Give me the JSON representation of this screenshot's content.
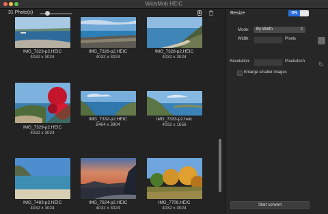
{
  "window": {
    "title": "WidsMob HEIC"
  },
  "toolbar": {
    "photo_count": "31 Photo(s)",
    "zoom": 0.2,
    "icons": [
      "phone-icon",
      "trash-icon"
    ]
  },
  "photos": [
    {
      "name": "IMG_7323-p2.HEIC",
      "size": "4032 x 3024",
      "scene": "lake"
    },
    {
      "name": "IMG_7326-p2.HEIC",
      "size": "4032 x 3024",
      "scene": "beach"
    },
    {
      "name": "IMG_7328-p2.HEIC",
      "size": "4032 x 3024",
      "scene": "coast"
    },
    {
      "name": "IMG_7329-p2.HEIC",
      "size": "4032 x 3024",
      "scene": "flowers"
    },
    {
      "name": "IMG_7332-p2.HEIC",
      "size": "8464 x 3904",
      "scene": "bay"
    },
    {
      "name": "IMG_7333-p2.heic",
      "size": "4032 x 1656",
      "scene": "hills"
    },
    {
      "name": "IMG_7483-p2.HEIC",
      "size": "4032 x 3024",
      "scene": "sea"
    },
    {
      "name": "IMG_7624-p2.HEIC",
      "size": "4032 x 3024",
      "scene": "sunset"
    },
    {
      "name": "IMG_7708.HEIC",
      "size": "4032 x 3024",
      "scene": "autumn"
    }
  ],
  "settings": {
    "title": "Resize",
    "toggle": "ON",
    "mode_label": "Mode:",
    "mode_value": "By Width",
    "width_label": "Width:",
    "width_unit": "Pixels",
    "resolution_label": "Resolution:",
    "resolution_unit": "Pixels/Inch",
    "enlarge_label": "Enlarge smaller images",
    "convert_label": "Start convert"
  },
  "colors": {
    "accent": "#2a6fdc",
    "background": "#232323",
    "panel": "#272727"
  }
}
